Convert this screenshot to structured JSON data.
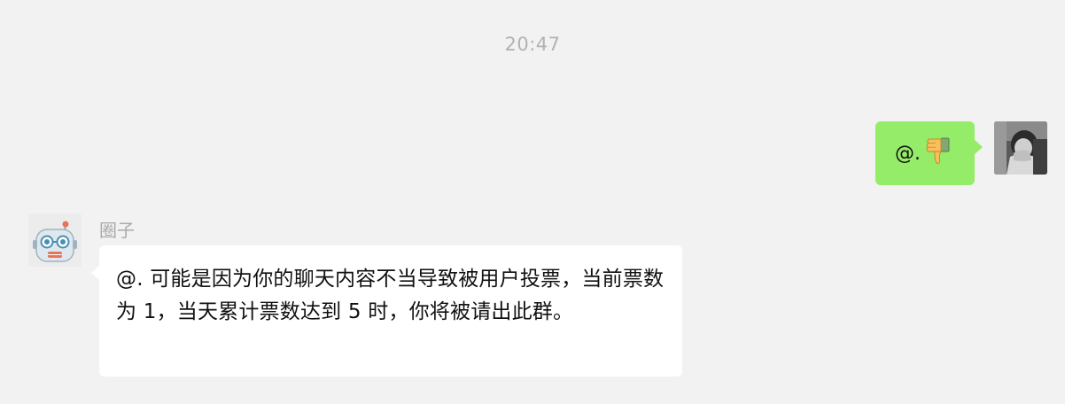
{
  "chat": {
    "timestamp": "20:47",
    "messages": [
      {
        "direction": "outgoing",
        "text": "@.",
        "emoji": "thumbs-down-icon",
        "bubble_color": "#95ec69"
      },
      {
        "direction": "incoming",
        "sender": "圈子",
        "text": "@. 可能是因为你的聊天内容不当导致被用户投票，当前票数为 1，当天累计票数达到 5 时，你将被请出此群。",
        "bubble_color": "#ffffff"
      }
    ]
  },
  "colors": {
    "background": "#f2f2f2",
    "timestamp": "#b2b2b2",
    "sender_name": "#a9a9a9"
  }
}
